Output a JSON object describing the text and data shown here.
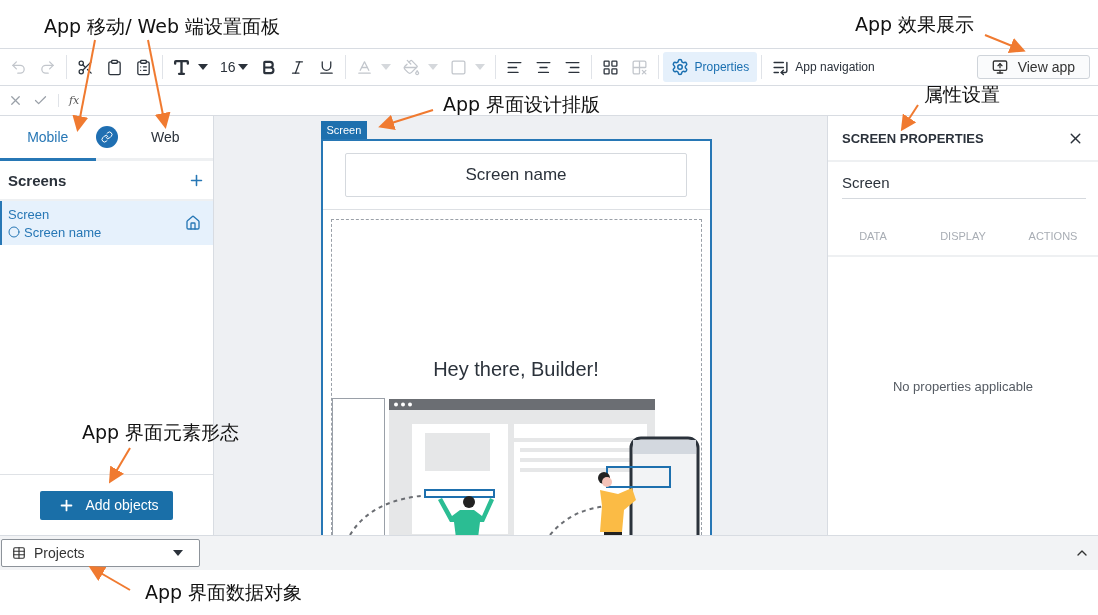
{
  "annotations": [
    {
      "text": "App 移动/ Web 端设置面板"
    },
    {
      "text": "App 效果展示"
    },
    {
      "text": "App 界面设计排版"
    },
    {
      "text": "属性设置"
    },
    {
      "text": "App 界面元素形态"
    },
    {
      "text": "App 界面数据对象"
    }
  ],
  "toolbar": {
    "tools": [
      {
        "disabled": true
      },
      {
        "disabled": true
      },
      {
        "disabled": false
      },
      {
        "disabled": false
      },
      {
        "disabled": false
      },
      {
        "disabled": false
      },
      {
        "disabled": false
      },
      {
        "disabled": false
      },
      {
        "disabled": false
      },
      {
        "disabled": true
      },
      {
        "disabled": true
      },
      {
        "disabled": true
      },
      {
        "disabled": false
      },
      {
        "disabled": false
      },
      {
        "disabled": false
      },
      {
        "disabled": false
      },
      {
        "disabled": true
      }
    ],
    "font_size": "16",
    "properties": {
      "label": "Properties",
      "selected": true
    },
    "app_navigation": "App navigation",
    "view_app": "View app"
  },
  "formula_bar": {
    "fx_label": "fx"
  },
  "left_panel": {
    "tabs": [
      {
        "label": "Mobile",
        "selected": true
      },
      {
        "label": "Web",
        "selected": false
      }
    ],
    "screens_title": "Screens",
    "screens": [
      {
        "title": "Screen",
        "name": "Screen name",
        "selected": true
      }
    ],
    "add_button": "Add objects"
  },
  "canvas": {
    "frame_tag": "Screen",
    "screen_name": "Screen name",
    "heading": "Hey there, Builder!"
  },
  "right_panel": {
    "title": "SCREEN PROPERTIES",
    "name_value": "Screen",
    "tabs": [
      {
        "label": "DATA",
        "disabled": true
      },
      {
        "label": "DISPLAY",
        "disabled": true
      },
      {
        "label": "ACTIONS",
        "disabled": true
      }
    ],
    "empty_text": "No properties applicable"
  },
  "bottom_bar": {
    "table_select": "Projects"
  }
}
